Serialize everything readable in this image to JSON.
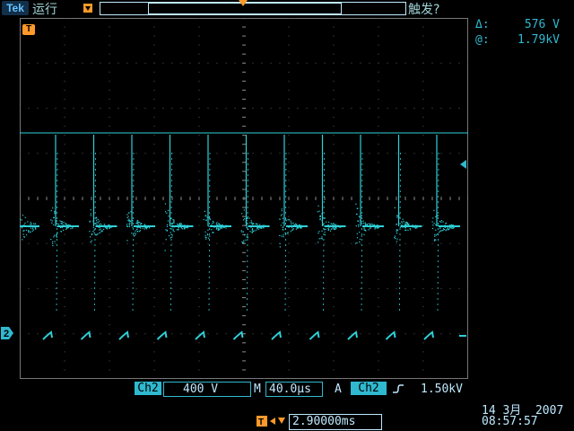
{
  "topbar": {
    "logo": "Tek",
    "run_state": "运行",
    "trigger_status": "触发?"
  },
  "cursor": {
    "delta_symbol": "Δ:",
    "delta_value": "576 V",
    "at_symbol": "@:",
    "at_value": "1.79kV"
  },
  "markers": {
    "trigger_T": "T",
    "channel": "2"
  },
  "bottom": {
    "channel_label": "Ch2",
    "vertical_scale": "400 V",
    "timebase_prefix": "M",
    "timebase": "40.0µs",
    "trigger_prefix": "A",
    "trigger_source": "Ch2",
    "trigger_slope_icon": "rising-edge-icon",
    "trigger_level": "1.50kV",
    "date": "14 3月  2007",
    "time": "08:57:57",
    "delay": "2.90000ms"
  },
  "colors": {
    "trace": "#2fd0d8",
    "graticule": "#5a5a5a",
    "trigger": "#ff9a2a",
    "accent": "#2fb9d0"
  },
  "waveform": {
    "pulses": 11,
    "description_hint": ""
  }
}
